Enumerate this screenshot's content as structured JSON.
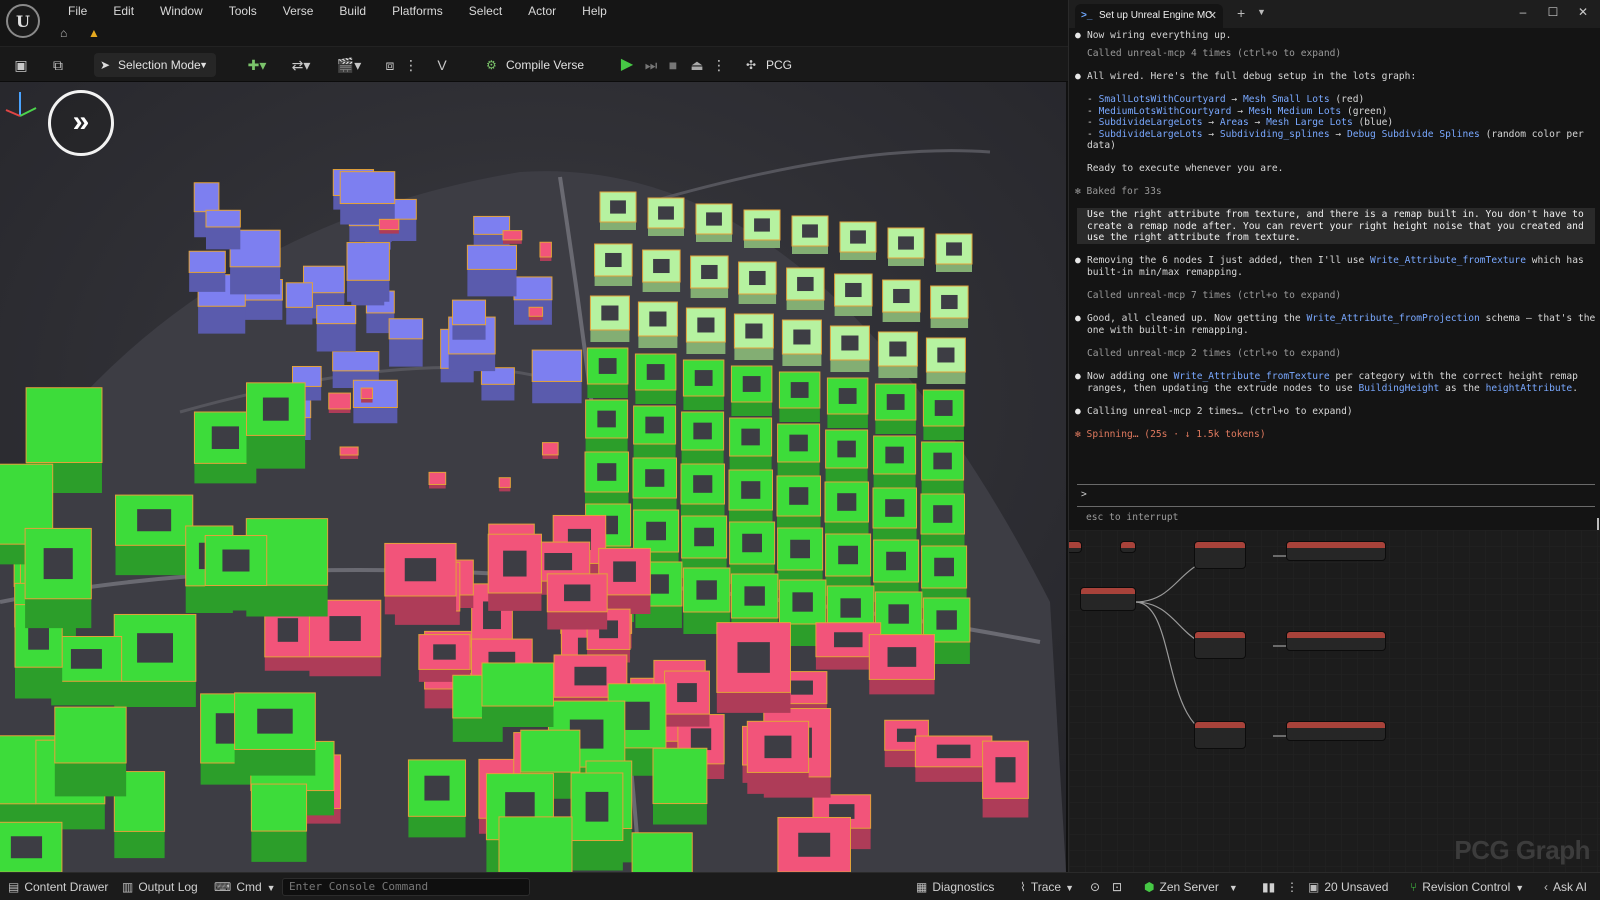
{
  "menubar": {
    "items": [
      "File",
      "Edit",
      "Window",
      "Tools",
      "Verse",
      "Build",
      "Platforms",
      "Select",
      "Actor",
      "Help"
    ]
  },
  "toolbar": {
    "selection_mode": "Selection Mode",
    "compile_verse": "Compile Verse",
    "pcg": "PCG"
  },
  "terminal": {
    "tab_title": "Set up Unreal Engine MC",
    "lines": [
      {
        "type": "bullet",
        "text": "Now wiring everything up."
      },
      {
        "type": "dim",
        "text": "Called unreal-mcp 4 times (ctrl+o to expand)"
      },
      {
        "type": "bullet",
        "text": "All wired. Here's the full debug setup in the lots graph:"
      },
      {
        "type": "list",
        "text": "- SmallLotsWithCourtyard → Mesh Small Lots (red)"
      },
      {
        "type": "list",
        "text": "- MediumLotsWithCourtyard → Mesh Medium Lots (green)"
      },
      {
        "type": "list",
        "text": "- SubdivideLargeLots → Areas → Mesh Large Lots (blue)"
      },
      {
        "type": "list",
        "text": "- SubdivideLargeLots → Subdividing_splines → Debug Subdivide Splines (random color per"
      },
      {
        "type": "list",
        "text": "data)"
      },
      {
        "type": "plain",
        "text": "Ready to execute whenever you are."
      },
      {
        "type": "dim",
        "text": "✻ Baked for 33s"
      },
      {
        "type": "prompt",
        "text": "Use the right attribute from texture, and there is a remap built in. You don't have to"
      },
      {
        "type": "prompt",
        "text": "create a remap node after. You can revert your right height noise that you created and"
      },
      {
        "type": "prompt",
        "text": "use the right attribute from texture."
      },
      {
        "type": "bullet",
        "text": "Removing the 6 nodes I just added, then I'll use Write_Attribute_fromTexture which has"
      },
      {
        "type": "cont",
        "text": "built-in min/max remapping."
      },
      {
        "type": "dim",
        "text": "Called unreal-mcp 7 times (ctrl+o to expand)"
      },
      {
        "type": "bullet",
        "text": "Good, all cleaned up. Now getting the Write_Attribute_fromProjection schema — that's the"
      },
      {
        "type": "cont",
        "text": "one with built-in remapping."
      },
      {
        "type": "dim",
        "text": "Called unreal-mcp 2 times (ctrl+o to expand)"
      },
      {
        "type": "bullet",
        "text": "Now adding one Write_Attribute_fromTexture per category with the correct height remap"
      },
      {
        "type": "cont",
        "text": "ranges, then updating the extrude nodes to use BuildingHeight as the heightAttribute."
      },
      {
        "type": "bullet",
        "text": "Calling unreal-mcp 2 times… (ctrl+o to expand)"
      },
      {
        "type": "spin",
        "text": "✻ Spinning… (25s · ↓ 1.5k tokens)"
      }
    ],
    "prompt_caret": ">",
    "interrupt_hint": "esc to interrupt"
  },
  "pcg_graph": {
    "watermark": "PCG Graph"
  },
  "statusbar": {
    "content_drawer": "Content Drawer",
    "output_log": "Output Log",
    "cmd": "Cmd",
    "console_placeholder": "Enter Console Command",
    "diagnostics": "Diagnostics",
    "trace": "Trace",
    "zen_server": "Zen Server",
    "unsaved": "20 Unsaved",
    "revision_control": "Revision Control",
    "ask_ai": "Ask AI"
  },
  "colors": {
    "lots_small": "#f2547a",
    "lots_medium": "#3ddc3a",
    "lots_large": "#7d7ff0",
    "lots_light": "#b6f2a0",
    "node_header": "#a8423a",
    "accent_link": "#79a8ff"
  }
}
